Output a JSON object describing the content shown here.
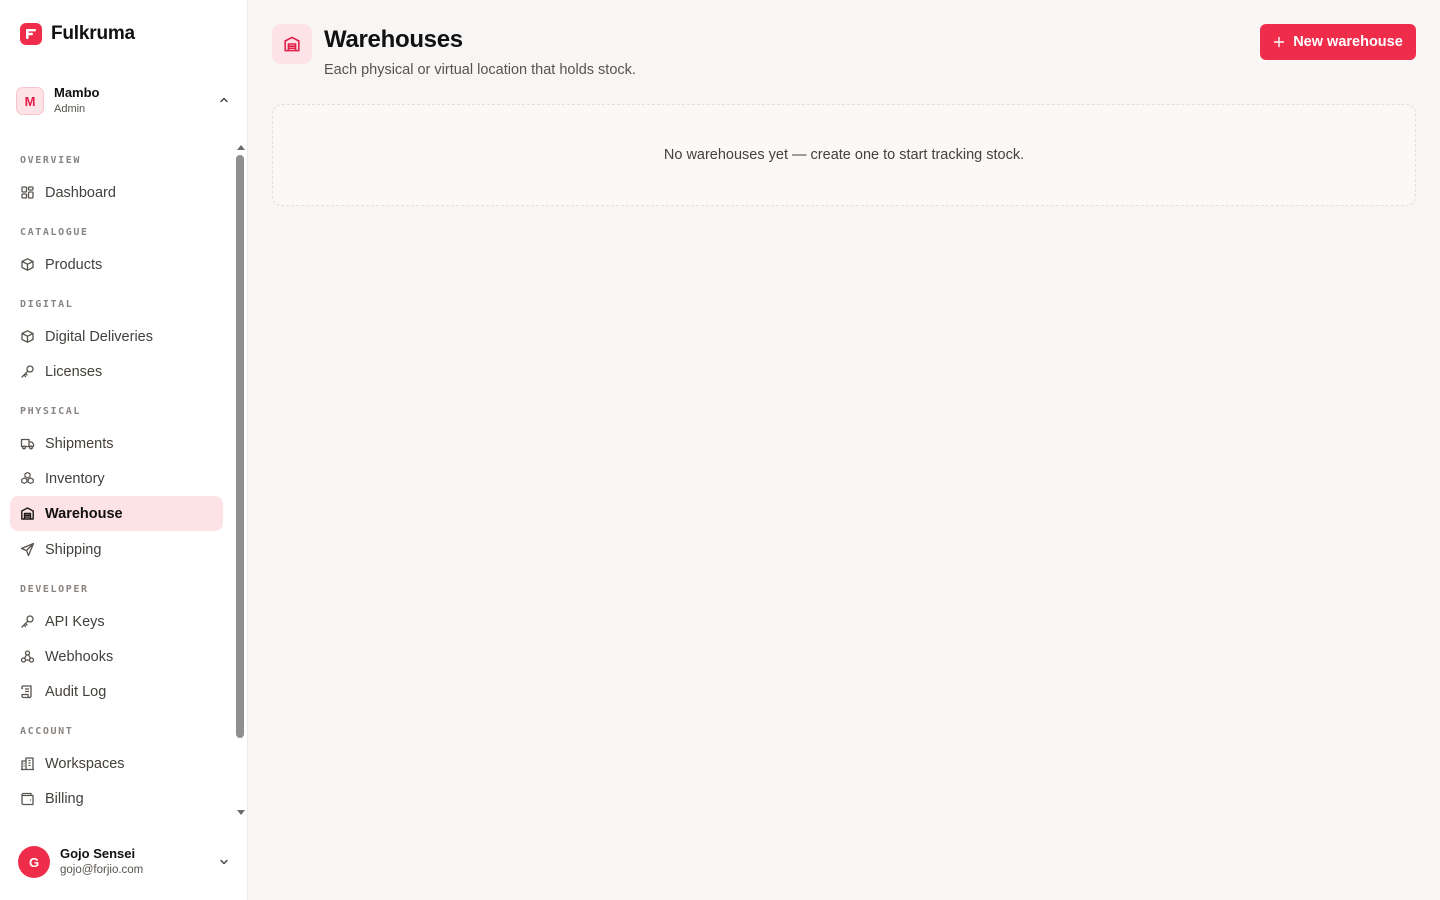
{
  "brand": {
    "name": "Fulkruma",
    "logo_icon": "fulkruma-logo-icon",
    "accent": "#ef2d4b"
  },
  "workspace": {
    "initial": "M",
    "name": "Mambo",
    "role": "Admin"
  },
  "nav": {
    "sections": [
      {
        "label": "OVERVIEW",
        "items": [
          {
            "label": "Dashboard",
            "icon": "dashboard-icon"
          }
        ]
      },
      {
        "label": "CATALOGUE",
        "items": [
          {
            "label": "Products",
            "icon": "box-icon"
          }
        ]
      },
      {
        "label": "DIGITAL",
        "items": [
          {
            "label": "Digital Deliveries",
            "icon": "box-icon"
          },
          {
            "label": "Licenses",
            "icon": "key-icon"
          }
        ]
      },
      {
        "label": "PHYSICAL",
        "items": [
          {
            "label": "Shipments",
            "icon": "truck-icon"
          },
          {
            "label": "Inventory",
            "icon": "boxes-icon"
          },
          {
            "label": "Warehouse",
            "icon": "warehouse-icon",
            "active": true
          },
          {
            "label": "Shipping",
            "icon": "send-icon"
          }
        ]
      },
      {
        "label": "DEVELOPER",
        "items": [
          {
            "label": "API Keys",
            "icon": "key-icon"
          },
          {
            "label": "Webhooks",
            "icon": "webhook-icon"
          },
          {
            "label": "Audit Log",
            "icon": "scroll-icon"
          }
        ]
      },
      {
        "label": "ACCOUNT",
        "items": [
          {
            "label": "Workspaces",
            "icon": "building-icon"
          },
          {
            "label": "Billing",
            "icon": "wallet-icon"
          }
        ]
      }
    ]
  },
  "user": {
    "initial": "G",
    "name": "Gojo Sensei",
    "email": "gojo@forjio.com"
  },
  "page": {
    "title": "Warehouses",
    "subtitle": "Each physical or virtual location that holds stock.",
    "icon": "warehouse-icon",
    "new_button_label": "New warehouse",
    "empty_message": "No warehouses yet — create one to start tracking stock."
  }
}
